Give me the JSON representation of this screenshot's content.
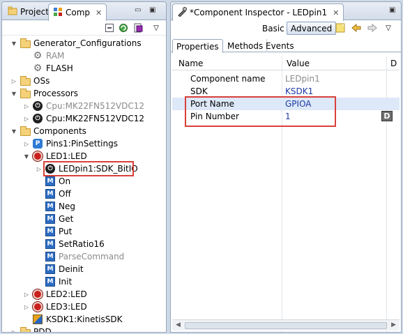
{
  "left_panel": {
    "tabs": [
      {
        "label": "Project",
        "icon": "project-icon"
      },
      {
        "label": "Comp",
        "icon": "components-icon",
        "close": "✕"
      }
    ],
    "tree": [
      {
        "indent": 0,
        "twisty": "▼",
        "icon": "folder",
        "label": "Generator_Configurations"
      },
      {
        "indent": 1,
        "twisty": "",
        "icon": "gear",
        "label": "RAM",
        "gray": true
      },
      {
        "indent": 1,
        "twisty": "",
        "icon": "gear",
        "label": "FLASH"
      },
      {
        "indent": 0,
        "twisty": "▷",
        "icon": "folder",
        "label": "OSs"
      },
      {
        "indent": 0,
        "twisty": "▼",
        "icon": "folder",
        "label": "Processors"
      },
      {
        "indent": 1,
        "twisty": "▷",
        "icon": "cpu",
        "label": "Cpu:MK22FN512VDC12",
        "gray": true
      },
      {
        "indent": 1,
        "twisty": "▷",
        "icon": "cpu",
        "label": "Cpu:MK22FN512VDC12"
      },
      {
        "indent": 0,
        "twisty": "▼",
        "icon": "folder",
        "label": "Components"
      },
      {
        "indent": 1,
        "twisty": "▷",
        "icon": "pins",
        "label": "Pins1:PinSettings"
      },
      {
        "indent": 1,
        "twisty": "▼",
        "icon": "led",
        "label": "LED1:LED"
      },
      {
        "indent": 2,
        "twisty": "▷",
        "icon": "cpu",
        "label": "LEDpin1:SDK_BitIO",
        "highlight": true
      },
      {
        "indent": 2,
        "twisty": "",
        "icon": "method",
        "label": "On"
      },
      {
        "indent": 2,
        "twisty": "",
        "icon": "method",
        "label": "Off"
      },
      {
        "indent": 2,
        "twisty": "",
        "icon": "method",
        "label": "Neg"
      },
      {
        "indent": 2,
        "twisty": "",
        "icon": "method",
        "label": "Get"
      },
      {
        "indent": 2,
        "twisty": "",
        "icon": "method",
        "label": "Put"
      },
      {
        "indent": 2,
        "twisty": "",
        "icon": "method",
        "label": "SetRatio16"
      },
      {
        "indent": 2,
        "twisty": "",
        "icon": "method",
        "label": "ParseCommand",
        "gray": true
      },
      {
        "indent": 2,
        "twisty": "",
        "icon": "method",
        "label": "Deinit"
      },
      {
        "indent": 2,
        "twisty": "",
        "icon": "method",
        "label": "Init"
      },
      {
        "indent": 1,
        "twisty": "▷",
        "icon": "led",
        "label": "LED2:LED"
      },
      {
        "indent": 1,
        "twisty": "▷",
        "icon": "led",
        "label": "LED3:LED"
      },
      {
        "indent": 1,
        "twisty": "",
        "icon": "ksdk",
        "label": "KSDK1:KinetisSDK"
      },
      {
        "indent": 0,
        "twisty": "▷",
        "icon": "folder",
        "label": "PDD"
      }
    ]
  },
  "right_panel": {
    "tab": {
      "label": "*Component Inspector - LEDpin1",
      "close": "✕"
    },
    "toolbar": {
      "basic_label": "Basic",
      "advanced_label": "Advanced"
    },
    "subtabs": [
      "Properties",
      "Methods",
      "Events"
    ],
    "columns": {
      "name": "Name",
      "value": "Value",
      "third": "D"
    },
    "properties": [
      {
        "name": "Component name",
        "value": "LEDpin1",
        "value_gray": true
      },
      {
        "name": "SDK",
        "value": "KSDK1"
      },
      {
        "name": "Port Name",
        "value": "GPIOA",
        "selected": true
      },
      {
        "name": "Pin Number",
        "value": "1",
        "button": "D"
      }
    ]
  },
  "colors": {
    "highlight_border": "#d9403a",
    "value_blue": "#1c39a3",
    "selection": "#dde8f8"
  }
}
